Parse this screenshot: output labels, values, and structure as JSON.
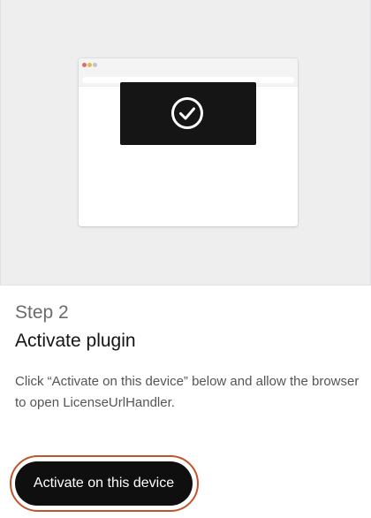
{
  "illustration": {
    "icons": [
      "check-circle-icon"
    ],
    "window_dot_colors": [
      "#e8685d",
      "#e6b84f",
      "#c4c4c6"
    ]
  },
  "step": {
    "label": "Step 2",
    "title": "Activate plugin",
    "description": "Click “Activate on this device” below and allow the browser to open LicenseUrlHandler."
  },
  "actions": {
    "activate_label": "Activate on this device"
  },
  "colors": {
    "button_bg": "#0f0f10",
    "focus_ring": "#c2542d",
    "illustration_bg": "#eeeeef"
  }
}
